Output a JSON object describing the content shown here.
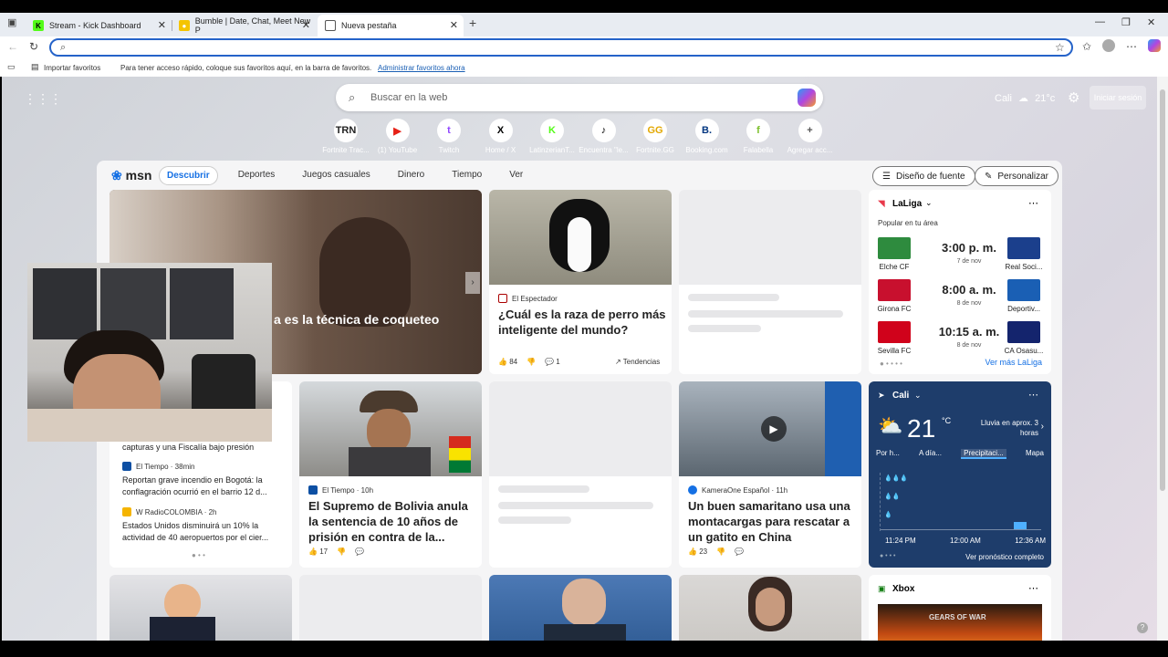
{
  "tabs": [
    {
      "label": "Stream - Kick Dashboard",
      "icon": "kick-icon",
      "color": "#53fc18"
    },
    {
      "label": "Bumble | Date, Chat, Meet New P",
      "icon": "bumble-icon",
      "color": "#f5c400"
    },
    {
      "label": "Nueva pestaña",
      "icon": "newtab-icon",
      "color": "#555"
    }
  ],
  "favorites_bar": {
    "import_label": "Importar favoritos",
    "message": "Para tener acceso rápido, coloque sus favoritos aquí, en la barra de favoritos.",
    "manage_link": "Administrar favoritos ahora"
  },
  "newtab": {
    "search_placeholder": "Buscar en la web",
    "weather_city": "Cali",
    "weather_temp": "21°c",
    "signin_label": "Iniciar sesión",
    "quick_links": [
      {
        "label": "Fortnite Trac...",
        "glyph": "TRN",
        "color": "#222"
      },
      {
        "label": "(1) YouTube",
        "glyph": "▶",
        "color": "#e62117"
      },
      {
        "label": "Twitch",
        "glyph": "t",
        "color": "#9146ff"
      },
      {
        "label": "Home / X",
        "glyph": "X",
        "color": "#000"
      },
      {
        "label": "LatinzerianT...",
        "glyph": "K",
        "color": "#53fc18"
      },
      {
        "label": "Encuentra \"le...",
        "glyph": "♪",
        "color": "#000"
      },
      {
        "label": "Fortnite.GG",
        "glyph": "GG",
        "color": "#e3a800"
      },
      {
        "label": "Booking.com",
        "glyph": "B.",
        "color": "#003580"
      },
      {
        "label": "Falabella",
        "glyph": "f",
        "color": "#7bbf2a"
      },
      {
        "label": "Agregar acc...",
        "glyph": "+",
        "color": "#555"
      }
    ]
  },
  "msn": {
    "logo": "msn",
    "tabs": [
      "Descubrir",
      "Deportes",
      "Juegos casuales",
      "Dinero",
      "Tiempo",
      "Ver"
    ],
    "design_button": "Diseño de fuente",
    "personalize_button": "Personalizar",
    "hero_title": "a es la técnica de coqueteo",
    "dog": {
      "source": "El Espectador",
      "title": "¿Cuál es la raza de perro más inteligente del mundo?",
      "likes": "84",
      "comments": "1",
      "trend": "Tendencias"
    },
    "news_list": [
      {
        "source": "",
        "text": "capturas y una Fiscalía bajo presión"
      },
      {
        "source": "El Tiempo · 38min",
        "text": "Reportan grave incendio en Bogotá: la conflagración ocurrió en el barrio 12 d..."
      },
      {
        "source": "W RadioCOLOMBIA · 2h",
        "text": "Estados Unidos disminuirá un 10% la actividad de 40 aeropuertos por el cier..."
      }
    ],
    "bolivia": {
      "source": "El Tiempo · 10h",
      "title": "El Supremo de Bolivia anula la sentencia de 10 años de prisión en contra de la...",
      "likes": "17"
    },
    "kitten": {
      "source": "KameraOne Español · 11h",
      "title": "Un buen samaritano usa una montacargas para rescatar a un gatito en China",
      "likes": "23"
    },
    "laliga": {
      "title": "LaLiga",
      "subtitle": "Popular en tu área",
      "more": "Ver más LaLiga",
      "matches": [
        {
          "home": "Elche CF",
          "away": "Real Soci...",
          "time": "3:00 p. m.",
          "date": "7 de nov",
          "home_color": "#2e8b3e",
          "away_color": "#1b3f8c"
        },
        {
          "home": "Girona FC",
          "away": "Deportiv...",
          "time": "8:00 a. m.",
          "date": "8 de nov",
          "home_color": "#c8102e",
          "away_color": "#1a5fb4"
        },
        {
          "home": "Sevilla FC",
          "away": "CA Osasu...",
          "time": "10:15 a. m.",
          "date": "8 de nov",
          "home_color": "#d0021b",
          "away_color": "#14246d"
        }
      ]
    },
    "weather": {
      "city": "Cali",
      "temp": "21",
      "unit": "°C",
      "rain_note": "Lluvia en aprox. 3 horas",
      "tabs": [
        "Por h...",
        "A día...",
        "Precipitaci...",
        "Mapa"
      ],
      "times": [
        "11:24 PM",
        "12:00 AM",
        "12:36 AM"
      ],
      "forecast_link": "Ver pronóstico completo"
    },
    "xbox": {
      "title": "Xbox",
      "banner": "GEARS OF WAR"
    }
  }
}
